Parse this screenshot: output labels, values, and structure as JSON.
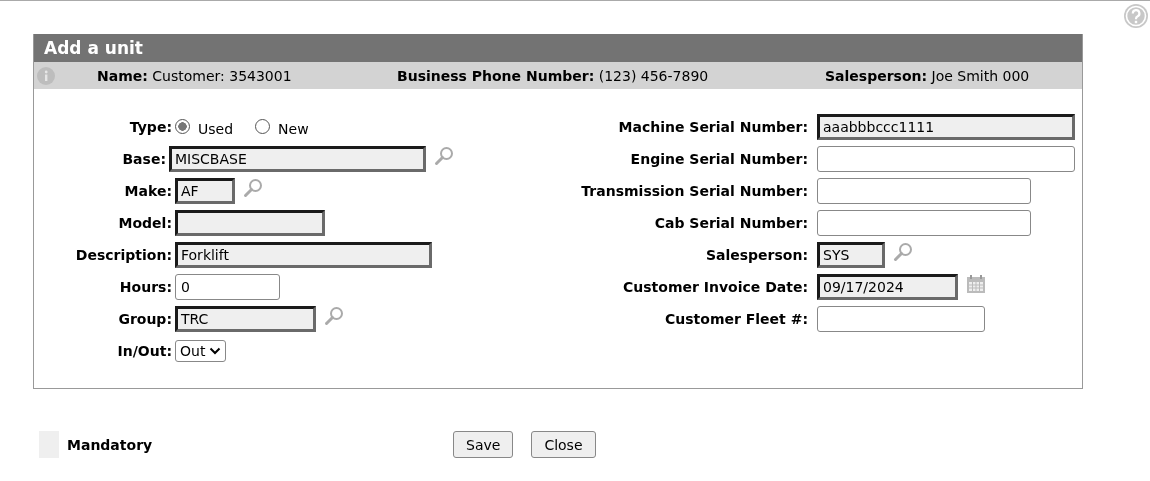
{
  "dialog": {
    "title": "Add a unit",
    "info_bar": [
      {
        "label": "Name:",
        "value": "Customer: 3543001"
      },
      {
        "label": "Business Phone Number:",
        "value": "(123) 456-7890"
      },
      {
        "label": "Salesperson:",
        "value": "Joe Smith 000"
      }
    ],
    "left_fields": [
      {
        "label": "Type:",
        "kind": "radio",
        "options": [
          {
            "label": "Used",
            "selected": true
          },
          {
            "label": "New",
            "selected": false
          }
        ]
      },
      {
        "label": "Base:",
        "kind": "lookup",
        "value": "MISCBASE",
        "mandatory": true
      },
      {
        "label": "Make:",
        "kind": "lookup",
        "value": "AF",
        "mandatory": true
      },
      {
        "label": "Model:",
        "kind": "text",
        "mandatory": true
      },
      {
        "label": "Description:",
        "kind": "text",
        "value": "Forklift",
        "mandatory": true
      },
      {
        "label": "Hours:",
        "kind": "text",
        "value": "0",
        "mandatory": false
      },
      {
        "label": "Group:",
        "kind": "lookup",
        "value": "TRC",
        "mandatory": true
      },
      {
        "label": "In/Out:",
        "kind": "select",
        "value": "Out"
      }
    ],
    "right_fields": [
      {
        "label": "Machine Serial Number:",
        "kind": "text",
        "value": "aaabbbccc1111",
        "mandatory": true
      },
      {
        "label": "Engine Serial Number:",
        "kind": "text",
        "mandatory": false
      },
      {
        "label": "Transmission Serial Number:",
        "kind": "text",
        "mandatory": false
      },
      {
        "label": "Cab Serial Number:",
        "kind": "text",
        "mandatory": false
      },
      {
        "label": "Salesperson:",
        "kind": "lookup",
        "value": "SYS",
        "mandatory": true
      },
      {
        "label": "Customer Invoice Date:",
        "kind": "date",
        "value": "09/17/2024",
        "mandatory": true
      },
      {
        "label": "Customer Fleet #:",
        "kind": "text",
        "mandatory": false
      }
    ]
  },
  "legend": {
    "label": "Mandatory"
  },
  "buttons": [
    "Save",
    "Close"
  ]
}
